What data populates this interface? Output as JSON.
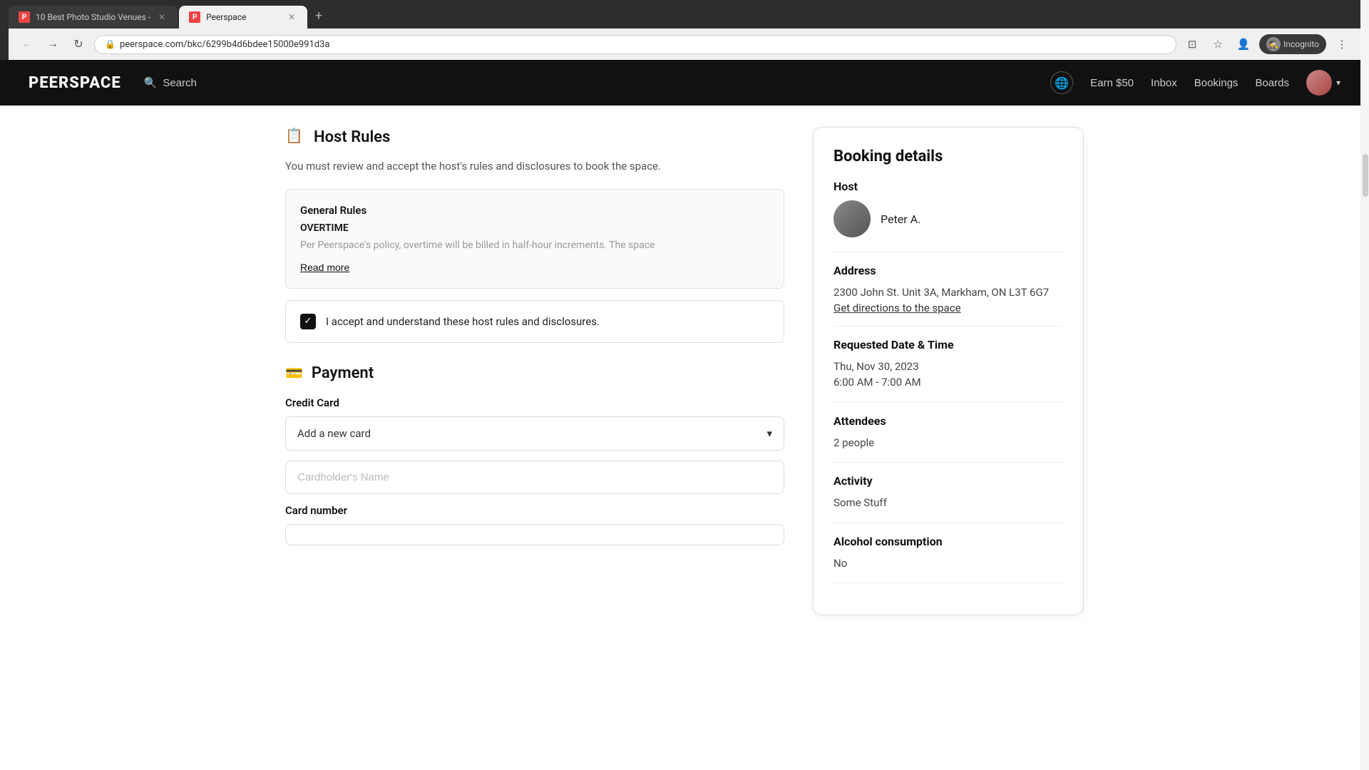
{
  "browser": {
    "tabs": [
      {
        "id": "tab1",
        "title": "10 Best Photo Studio Venues -",
        "favicon": "P",
        "active": false
      },
      {
        "id": "tab2",
        "title": "Peerspace",
        "favicon": "P",
        "active": true
      }
    ],
    "new_tab_label": "+",
    "address": "peerspace.com/bkc/6299b4d6bdee15000e991d3a",
    "incognito_label": "Incognito"
  },
  "header": {
    "logo": "PEERSPACE",
    "search_label": "Search",
    "earn_label": "Earn $50",
    "inbox_label": "Inbox",
    "bookings_label": "Bookings",
    "boards_label": "Boards"
  },
  "host_rules": {
    "section_title": "Host Rules",
    "subtitle": "You must review and accept the host's rules and disclosures to book the space.",
    "general_rules_title": "General Rules",
    "overtime_title": "OVERTIME",
    "overtime_text": "Per Peerspace's policy, overtime will be billed in half-hour increments. The space",
    "read_more_label": "Read more",
    "checkbox_label": "I accept and understand these host rules and disclosures.",
    "checkbox_checked": true
  },
  "payment": {
    "section_title": "Payment",
    "credit_card_label": "Credit Card",
    "add_card_placeholder": "Add a new card",
    "cardholder_name_placeholder": "Cardholder's Name",
    "card_number_label": "Card number"
  },
  "booking_details": {
    "title": "Booking details",
    "host_label": "Host",
    "host_name": "Peter A.",
    "address_label": "Address",
    "address_line1": "2300 John St. Unit 3A, Markham, ON L3T 6G7",
    "get_directions_label": "Get directions to the space",
    "date_time_label": "Requested Date & Time",
    "date": "Thu, Nov 30, 2023",
    "time": "6:00 AM - 7:00 AM",
    "attendees_label": "Attendees",
    "attendees_value": "2 people",
    "activity_label": "Activity",
    "activity_value": "Some Stuff",
    "alcohol_label": "Alcohol consumption",
    "alcohol_value": "No"
  }
}
